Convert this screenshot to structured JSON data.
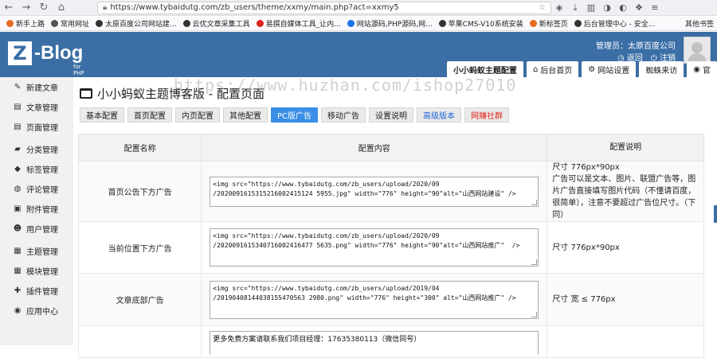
{
  "browser": {
    "url": "https://www.tybaidutg.com/zb_users/theme/xxmy/main.php?act=xxmy5",
    "bookmarks": [
      {
        "label": "新手上路",
        "color": "#e66b1f"
      },
      {
        "label": "常用网址",
        "color": "#555555"
      },
      {
        "label": "太原百度公司网站建...",
        "color": "#333333"
      },
      {
        "label": "云优文章采集工具",
        "color": "#333333"
      },
      {
        "label": "易撰自媒体工具_让内...",
        "color": "#e0241b"
      },
      {
        "label": "网站源码,PHP源码,网...",
        "color": "#1a73e8"
      },
      {
        "label": "苹果CMS-V10系统安装",
        "color": "#333333"
      },
      {
        "label": "新标签页",
        "color": "#e66b1f"
      },
      {
        "label": "后台管理中心 - 安全...",
        "color": "#333333"
      }
    ],
    "other_bookmarks": "其他书签"
  },
  "header": {
    "logo_letter": "Z",
    "logo_text": "-Blog",
    "logo_sub": "for PHP",
    "admin_name": "管理员：太原百度公司",
    "back_label": "返回",
    "logout_label": "注销",
    "nav": [
      {
        "label": "小小蚂蚁主题配置",
        "icon": ""
      },
      {
        "label": "后台首页",
        "icon": "⌂"
      },
      {
        "label": "网站设置",
        "icon": "⚙"
      },
      {
        "label": "蜘蛛来访",
        "icon": ""
      },
      {
        "label": "官",
        "icon": "◉"
      }
    ]
  },
  "sidebar": {
    "items": [
      {
        "label": "新建文章",
        "icon": "✎"
      },
      {
        "label": "文章管理",
        "icon": "▤"
      },
      {
        "label": "页面管理",
        "icon": "▤"
      },
      {
        "label": "分类管理",
        "icon": "▰"
      },
      {
        "label": "标签管理",
        "icon": "◆"
      },
      {
        "label": "评论管理",
        "icon": "◍"
      },
      {
        "label": "附件管理",
        "icon": "▣"
      },
      {
        "label": "用户管理",
        "icon": "☻"
      },
      {
        "label": "主题管理",
        "icon": "▦"
      },
      {
        "label": "模块管理",
        "icon": "▦"
      },
      {
        "label": "插件管理",
        "icon": "✚"
      },
      {
        "label": "应用中心",
        "icon": "◉"
      }
    ]
  },
  "page": {
    "title": "小小蚂蚁主题博客版 - 配置页面",
    "tabs": [
      "基本配置",
      "首页配置",
      "内页配置",
      "其他配置",
      "PC版广告",
      "移动广告",
      "设置说明",
      "高级版本",
      "网赚社群"
    ],
    "active_tab": 4
  },
  "table": {
    "headers": [
      "配置名称",
      "配置内容",
      "配置说明"
    ],
    "rows": [
      {
        "name": "首页公告下方广告",
        "content": "<img src=\"https://www.tybaidutg.com/zb_users/upload/2020/09\n/2020091615315216002415124 5955.jpg\" width=\"776\" height=\"90\"alt=\"山西网站建设\" />",
        "desc": "尺寸 776px*90px\n广告可以是文本、图片、联盟广告等，图片广告直接填写图片代码（不懂请百度，很简单），注意不要超过广告位尺寸。（下同）"
      },
      {
        "name": "当前位置下方广告",
        "content": "<img src=\"https://www.tybaidutg.com/zb_users/upload/2020/09\n/2020091615340716002416477 5635.png\" width=\"776\" height=\"90\"alt=\"山西网站推广\"  />",
        "desc": "尺寸 776px*90px"
      },
      {
        "name": "文章底部广告",
        "content": "<img src=\"https://www.tybaidutg.com/zb_users/upload/2019/04\n/20190408144038155470563 2980.png\" width=\"776\" height=\"300\" alt=\"山西网站推广\" />",
        "desc": "尺寸 宽 ≤ 776px"
      }
    ],
    "partial_content": "更多免费方案请联系我们项目经理：17635380113（微信同号）"
  },
  "watermark": "https://www.huzhan.com/ishop27010"
}
